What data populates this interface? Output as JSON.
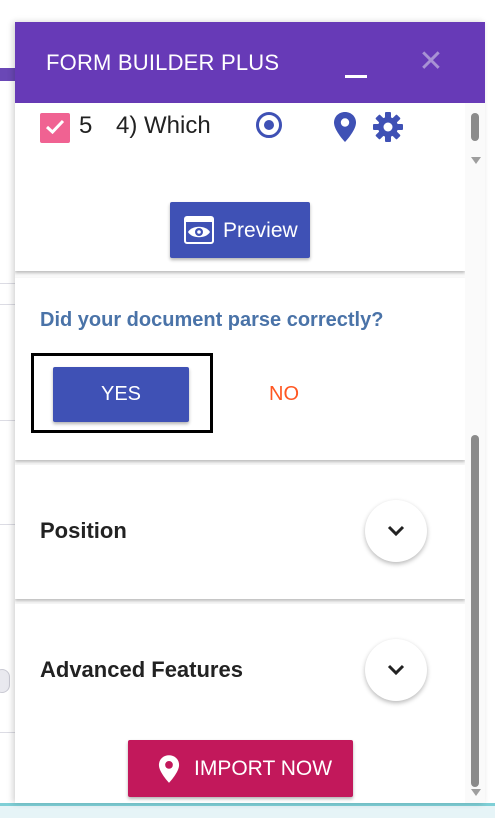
{
  "app": {
    "title": "FORM BUILDER PLUS"
  },
  "question": {
    "number": "5",
    "text": "4) Which",
    "checked": true
  },
  "buttons": {
    "preview": "Preview",
    "yes": "YES",
    "no": "NO",
    "import": "IMPORT NOW"
  },
  "parse": {
    "question": "Did your document parse correctly?"
  },
  "sections": {
    "position": "Position",
    "advanced": "Advanced Features"
  },
  "colors": {
    "header": "#673ab7",
    "primary": "#3f51b5",
    "accent_pink": "#c2185b",
    "checkbox": "#f06292",
    "no_text": "#ff5722",
    "parse_text": "#4a73a8"
  },
  "icons": {
    "minimize": "minimize-icon",
    "close": "close-icon",
    "checkbox": "checkbox-checked-icon",
    "radio": "radio-button-icon",
    "location": "location-pin-icon",
    "settings": "gear-icon",
    "preview": "eye-icon",
    "expand": "chevron-down-icon"
  }
}
